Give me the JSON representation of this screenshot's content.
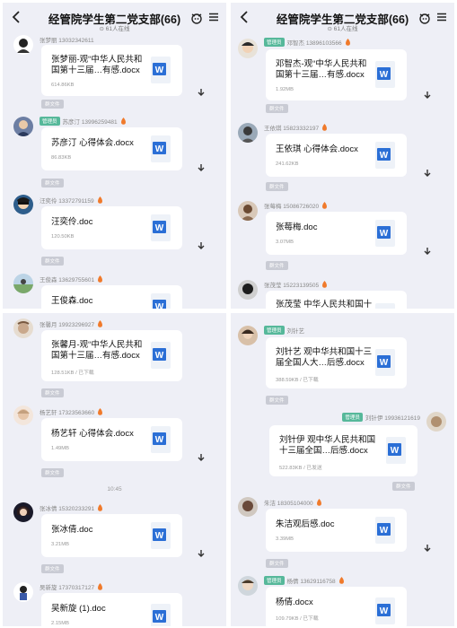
{
  "header": {
    "title": "经管院学生第二党支部(66)",
    "subtitle": "61人在线"
  },
  "file_tag": "群文件",
  "time_separator": "10:45",
  "panel1": {
    "messages": [
      {
        "sender": "张梦丽 13032342611",
        "role": "",
        "file": "张梦丽-观“中华人民共和国第十三届…有感.docx",
        "size": "614.86KB"
      },
      {
        "sender": "苏彦汀 13996259481",
        "role": "管理员",
        "file": "苏彦汀 心得体会.docx",
        "size": "86.83KB"
      },
      {
        "sender": "汪奕伶 13372791159",
        "role": "",
        "file": "汪奕伶.doc",
        "size": "120.50KB"
      },
      {
        "sender": "王俊森 13629755601",
        "role": "",
        "file": "王俊森.doc",
        "size": ""
      }
    ]
  },
  "panel2": {
    "messages": [
      {
        "sender": "邓智杰 13896103566",
        "role": "管理员",
        "file": "邓智杰-观“中华人民共和国第十三届…有感.docx",
        "size": "1.92MB"
      },
      {
        "sender": "王依琪 15823332197",
        "role": "",
        "file": "王依琪 心得体会.docx",
        "size": "241.62KB"
      },
      {
        "sender": "张莓梅 15086726020",
        "role": "",
        "file": "张莓梅.doc",
        "size": "3.07MB"
      },
      {
        "sender": "张茂莹 15223139505",
        "role": "",
        "file": "张茂莹 中华人民共和国十",
        "size": ""
      }
    ]
  },
  "panel3": {
    "messages": [
      {
        "sender": "张馨月 19923296927",
        "role": "",
        "file": "张馨月-观“中华人民共和国第十三届…有感.docx",
        "size": "128.51KB / 已下载"
      },
      {
        "sender": "杨艺轩 17323563660",
        "role": "",
        "file": "杨艺轩 心得体会.docx",
        "size": "1.49MB"
      },
      {
        "sender": "张冰倩 15320233291",
        "role": "",
        "file": "张冰倩.doc",
        "size": "3.21MB"
      },
      {
        "sender": "吴新旋 17370317127",
        "role": "",
        "file": "吴新旋 (1).doc",
        "size": "2.15MB"
      }
    ]
  },
  "panel4": {
    "messages": [
      {
        "sender": "刘针艺",
        "role": "管理员",
        "file": "刘针艺 观中华共和国十三届全国人大…后感.docx",
        "size": "388.59KB / 已下载"
      },
      {
        "sender": "刘针伊 19936121619",
        "role": "管理员",
        "file": "刘针伊 观中华人民共和国十三届全国…后感.docx",
        "size": "522.83KB / 已发送"
      },
      {
        "sender": "朱洁 18305104000",
        "role": "",
        "file": "朱洁观后感.doc",
        "size": "3.39MB"
      },
      {
        "sender": "杨倩 13629116758",
        "role": "管理员",
        "file": "杨倩.docx",
        "size": "109.79KB / 已下载"
      }
    ]
  },
  "colors": {
    "background": "#eeeff6",
    "badge": "#56b89a",
    "word_blue": "#2b6fd6",
    "tag": "#c9cbd4"
  }
}
